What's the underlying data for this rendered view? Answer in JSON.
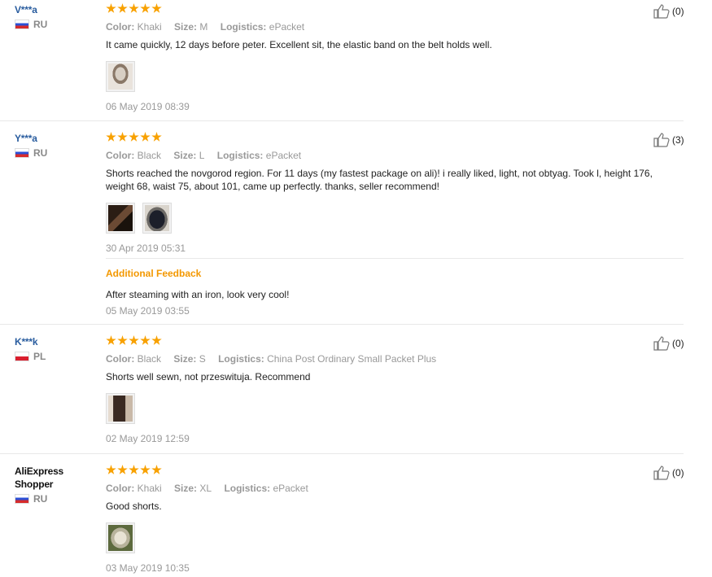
{
  "reviews": [
    {
      "user": "V***a",
      "country": "RU",
      "rating": 5,
      "color_label": "Color:",
      "color": "Khaki",
      "size_label": "Size:",
      "size": "M",
      "logistics_label": "Logistics:",
      "logistics": "ePacket",
      "text": "It came quickly, 12 days before peter. Excellent sit, the elastic band on the belt holds well.",
      "photos": 1,
      "date": "06 May 2019 08:39",
      "helpful": "(0)"
    },
    {
      "user": "Y***a",
      "country": "RU",
      "rating": 5,
      "color_label": "Color:",
      "color": "Black",
      "size_label": "Size:",
      "size": "L",
      "logistics_label": "Logistics:",
      "logistics": "ePacket",
      "text": "Shorts reached the novgorod region. For 11 days (my fastest package on ali)! i really liked, light, not obtyag. Took l, height 176, weight 68, waist 75, about 101, came up perfectly. thanks, seller recommend!",
      "photos": 2,
      "date": "30 Apr 2019 05:31",
      "helpful": "(3)",
      "additional_title": "Additional Feedback",
      "additional_text": "After steaming with an iron, look very cool!",
      "additional_date": "05 May 2019 03:55"
    },
    {
      "user": "K***k",
      "country": "PL",
      "rating": 5,
      "color_label": "Color:",
      "color": "Black",
      "size_label": "Size:",
      "size": "S",
      "logistics_label": "Logistics:",
      "logistics": "China Post Ordinary Small Packet Plus",
      "text": "Shorts well sewn, not przeswituja. Recommend",
      "photos": 1,
      "date": "02 May 2019 12:59",
      "helpful": "(0)"
    },
    {
      "user_line1": "AliExpress",
      "user_line2": "Shopper",
      "country": "RU",
      "rating": 5,
      "color_label": "Color:",
      "color": "Khaki",
      "size_label": "Size:",
      "size": "XL",
      "logistics_label": "Logistics:",
      "logistics": "ePacket",
      "text": "Good shorts.",
      "photos": 1,
      "date": "03 May 2019 10:35",
      "helpful": "(0)"
    }
  ],
  "colors": {
    "star": "#f8a100",
    "user_link": "#2a5d9f",
    "additional_title": "#f39800",
    "muted": "#999999"
  },
  "icons": {
    "helpful": "thumbs-up-icon",
    "rating": "star-icon"
  }
}
